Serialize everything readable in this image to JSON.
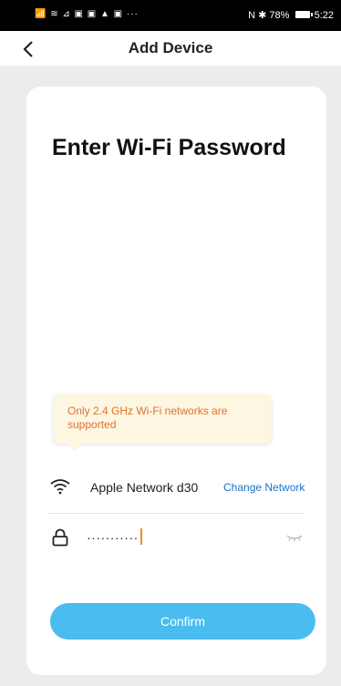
{
  "status_bar": {
    "left_icons": "📶 ≋ ⊿ ▣ ▣ ▲ ▣ ···",
    "nfc": "N",
    "bluetooth": "✱",
    "battery_percent": "78%",
    "time": "5:22"
  },
  "nav": {
    "back_icon": "chevron-left-icon",
    "title": "Add Device"
  },
  "card": {
    "heading": "Enter Wi-Fi Password",
    "tooltip": "Only 2.4 GHz Wi-Fi networks are supported",
    "network": {
      "icon": "wifi-icon",
      "name": "Apple Network d30",
      "change_label": "Change Network"
    },
    "password": {
      "icon": "lock-icon",
      "value": "···········",
      "visibility_icon": "eye-closed-icon"
    },
    "confirm_label": "Confirm"
  },
  "colors": {
    "accent": "#4bbcf0",
    "link": "#1a73c8",
    "warning_text": "#e0722e",
    "warning_bg": "#fdf6e1"
  }
}
